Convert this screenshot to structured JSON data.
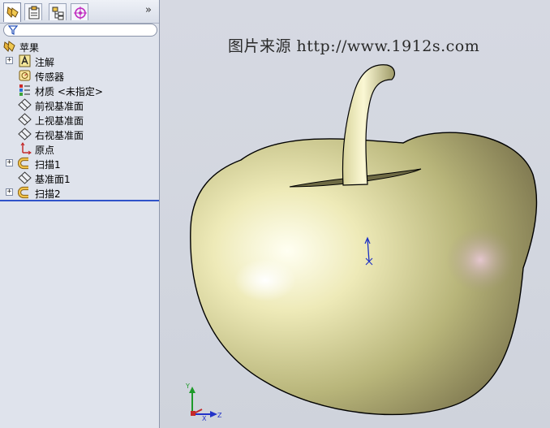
{
  "feature_manager": {
    "tabs": [
      {
        "name": "feature-manager-tab",
        "icon": "feature-tree-icon",
        "active": true
      },
      {
        "name": "property-manager-tab",
        "icon": "property-manager-icon",
        "active": false
      },
      {
        "name": "configuration-manager-tab",
        "icon": "configuration-icon",
        "active": false
      },
      {
        "name": "dimxpert-tab",
        "icon": "target-icon",
        "active": false
      }
    ],
    "expand_glyph": "»",
    "tree": {
      "root": {
        "label": "苹果",
        "icon": "part-icon"
      },
      "items": [
        {
          "label": "注解",
          "icon": "annotations-icon",
          "expandable": true
        },
        {
          "label": "传感器",
          "icon": "sensor-icon",
          "expandable": false
        },
        {
          "label": "材质 <未指定>",
          "icon": "material-icon",
          "expandable": false
        },
        {
          "label": "前视基准面",
          "icon": "plane-icon",
          "expandable": false
        },
        {
          "label": "上视基准面",
          "icon": "plane-icon",
          "expandable": false
        },
        {
          "label": "右视基准面",
          "icon": "plane-icon",
          "expandable": false
        },
        {
          "label": "原点",
          "icon": "origin-icon",
          "expandable": false
        },
        {
          "label": "扫描1",
          "icon": "sweep-icon",
          "expandable": true
        },
        {
          "label": "基准面1",
          "icon": "plane-icon",
          "expandable": false
        },
        {
          "label": "扫描2",
          "icon": "sweep-icon",
          "expandable": true
        }
      ],
      "expand_glyph": "+"
    }
  },
  "viewport": {
    "watermark": "图片来源 http://www.1912s.com",
    "model_color": "#e8e6b0",
    "triad": {
      "x_label": "X",
      "y_label": "Y",
      "z_label": "Z"
    }
  }
}
